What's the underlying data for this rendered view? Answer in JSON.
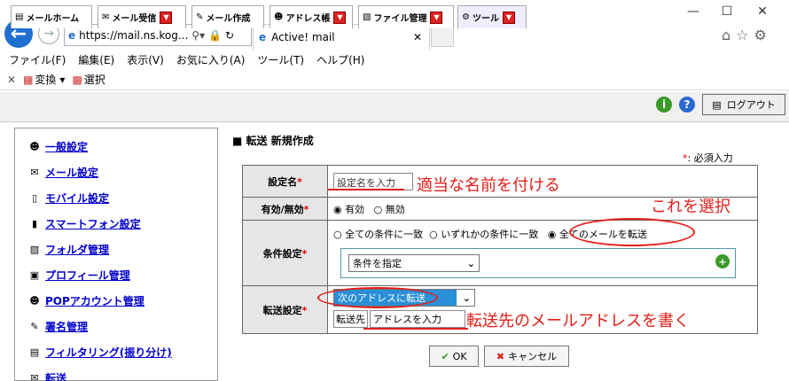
{
  "browser": {
    "url": "https://mail.ns.kog...",
    "tab_title": "Active! mail",
    "menu": [
      "ファイル(F)",
      "編集(E)",
      "表示(V)",
      "お気に入り(A)",
      "ツール(T)",
      "ヘルプ(H)"
    ],
    "cmd_convert": "変換",
    "cmd_select": "選択"
  },
  "apptabs": [
    "メールホーム",
    "メール受信",
    "メール作成",
    "アドレス帳",
    "ファイル管理",
    "ツール"
  ],
  "logout": "ログアウト",
  "sidebar": [
    "一般設定",
    "メール設定",
    "モバイル設定",
    "スマートフォン設定",
    "フォルダ管理",
    "プロフィール管理",
    "POPアカウント管理",
    "署名管理",
    "フィルタリング(振り分け)",
    "転送"
  ],
  "page": {
    "title": "転送 新規作成",
    "required_mark": "*",
    "required_note": ": 必須入力"
  },
  "form": {
    "name_label": "設定名",
    "name_placeholder": "設定名を入力",
    "enable_label": "有効/無効",
    "enable_on": "有効",
    "enable_off": "無効",
    "cond_label": "条件設定",
    "cond_all": "全ての条件に一致",
    "cond_any": "いずれかの条件に一致",
    "cond_allmail": "全てのメールを転送",
    "cond_select": "条件を指定",
    "fwd_label": "転送設定",
    "fwd_select": "次のアドレスに転送",
    "fwd_to": "転送先",
    "fwd_placeholder": "アドレスを入力"
  },
  "buttons": {
    "ok": "OK",
    "cancel": "キャンセル"
  },
  "annotations": {
    "name": "適当な名前を付ける",
    "select": "これを選択",
    "address": "転送先のメールアドレスを書く"
  },
  "colors": {
    "annotation": "#e0201a",
    "selected_option": "#2a8fd6",
    "link": "#0000cc"
  }
}
